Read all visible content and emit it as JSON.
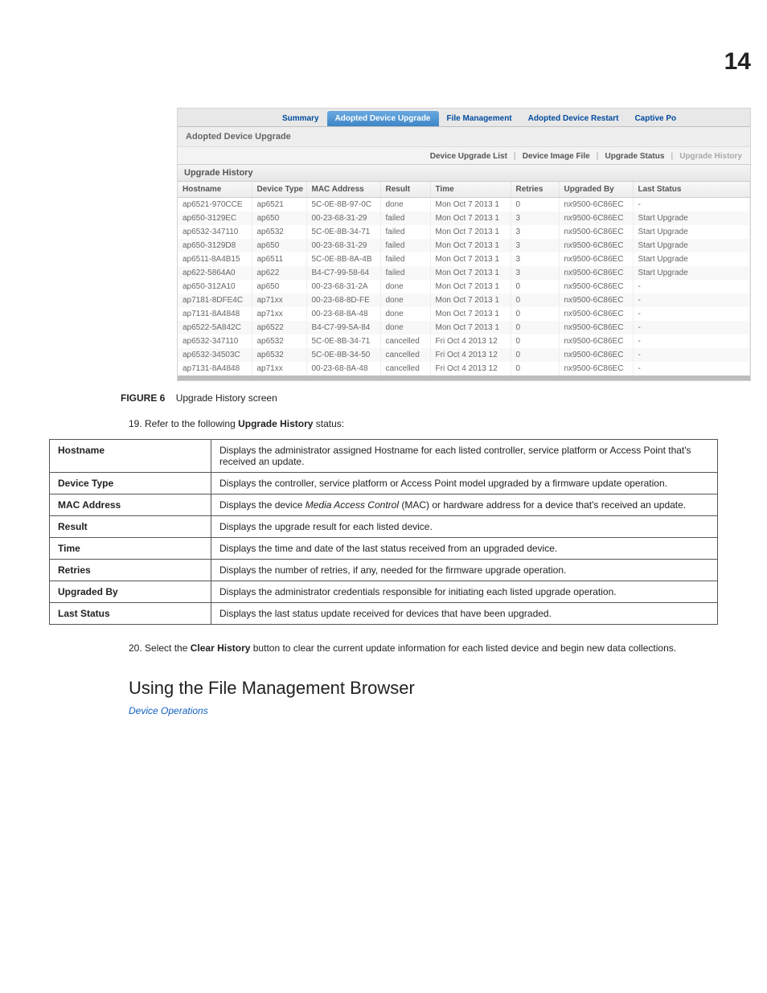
{
  "page_number": "14",
  "tabs": [
    "Summary",
    "Adopted Device Upgrade",
    "File Management",
    "Adopted Device Restart",
    "Captive Po"
  ],
  "panel_title": "Adopted Device Upgrade",
  "subtabs": [
    "Device Upgrade List",
    "Device Image File",
    "Upgrade Status",
    "Upgrade History"
  ],
  "table_caption": "Upgrade History",
  "columns": [
    "Hostname",
    "Device Type",
    "MAC Address",
    "Result",
    "Time",
    "Retries",
    "Upgraded By",
    "Last Status"
  ],
  "rows": [
    {
      "hostname": "ap6521-970CCE",
      "device": "ap6521",
      "mac": "5C-0E-8B-97-0C",
      "result": "done",
      "time": "Mon Oct 7 2013 1",
      "retries": "0",
      "by": "nx9500-6C86EC",
      "last": "-"
    },
    {
      "hostname": "ap650-3129EC",
      "device": "ap650",
      "mac": "00-23-68-31-29",
      "result": "failed",
      "time": "Mon Oct 7 2013 1",
      "retries": "3",
      "by": "nx9500-6C86EC",
      "last": "Start Upgrade"
    },
    {
      "hostname": "ap6532-347110",
      "device": "ap6532",
      "mac": "5C-0E-8B-34-71",
      "result": "failed",
      "time": "Mon Oct 7 2013 1",
      "retries": "3",
      "by": "nx9500-6C86EC",
      "last": "Start Upgrade"
    },
    {
      "hostname": "ap650-3129D8",
      "device": "ap650",
      "mac": "00-23-68-31-29",
      "result": "failed",
      "time": "Mon Oct 7 2013 1",
      "retries": "3",
      "by": "nx9500-6C86EC",
      "last": "Start Upgrade"
    },
    {
      "hostname": "ap6511-8A4B15",
      "device": "ap6511",
      "mac": "5C-0E-8B-8A-4B",
      "result": "failed",
      "time": "Mon Oct 7 2013 1",
      "retries": "3",
      "by": "nx9500-6C86EC",
      "last": "Start Upgrade"
    },
    {
      "hostname": "ap622-5864A0",
      "device": "ap622",
      "mac": "B4-C7-99-58-64",
      "result": "failed",
      "time": "Mon Oct 7 2013 1",
      "retries": "3",
      "by": "nx9500-6C86EC",
      "last": "Start Upgrade"
    },
    {
      "hostname": "ap650-312A10",
      "device": "ap650",
      "mac": "00-23-68-31-2A",
      "result": "done",
      "time": "Mon Oct 7 2013 1",
      "retries": "0",
      "by": "nx9500-6C86EC",
      "last": "-"
    },
    {
      "hostname": "ap7181-8DFE4C",
      "device": "ap71xx",
      "mac": "00-23-68-8D-FE",
      "result": "done",
      "time": "Mon Oct 7 2013 1",
      "retries": "0",
      "by": "nx9500-6C86EC",
      "last": "-"
    },
    {
      "hostname": "ap7131-8A4848",
      "device": "ap71xx",
      "mac": "00-23-68-8A-48",
      "result": "done",
      "time": "Mon Oct 7 2013 1",
      "retries": "0",
      "by": "nx9500-6C86EC",
      "last": "-"
    },
    {
      "hostname": "ap6522-5A842C",
      "device": "ap6522",
      "mac": "B4-C7-99-5A-84",
      "result": "done",
      "time": "Mon Oct 7 2013 1",
      "retries": "0",
      "by": "nx9500-6C86EC",
      "last": "-"
    },
    {
      "hostname": "ap6532-347110",
      "device": "ap6532",
      "mac": "5C-0E-8B-34-71",
      "result": "cancelled",
      "time": "Fri Oct 4 2013 12",
      "retries": "0",
      "by": "nx9500-6C86EC",
      "last": "-"
    },
    {
      "hostname": "ap6532-34503C",
      "device": "ap6532",
      "mac": "5C-0E-8B-34-50",
      "result": "cancelled",
      "time": "Fri Oct 4 2013 12",
      "retries": "0",
      "by": "nx9500-6C86EC",
      "last": "-"
    },
    {
      "hostname": "ap7131-8A4848",
      "device": "ap71xx",
      "mac": "00-23-68-8A-48",
      "result": "cancelled",
      "time": "Fri Oct 4 2013 12",
      "retries": "0",
      "by": "nx9500-6C86EC",
      "last": "-"
    }
  ],
  "figure": {
    "label": "FIGURE 6",
    "text": "Upgrade History screen"
  },
  "step19": {
    "num": "19. ",
    "pre": "Refer to the following ",
    "bold": "Upgrade History",
    "post": " status:"
  },
  "desc": [
    {
      "k": "Hostname",
      "v": "Displays the administrator assigned Hostname for each listed controller, service platform or Access Point that's received an update."
    },
    {
      "k": "Device Type",
      "v": "Displays the controller, service platform or Access Point model upgraded by a firmware update operation."
    },
    {
      "k": "MAC Address",
      "v": "Displays the device <em>Media Access Control</em> (MAC) or hardware address for a device that's received an update."
    },
    {
      "k": "Result",
      "v": "Displays the upgrade result for each listed device."
    },
    {
      "k": "Time",
      "v": "Displays the time and date of the last status received from an upgraded device."
    },
    {
      "k": "Retries",
      "v": "Displays the number of retries, if any, needed for the firmware upgrade operation."
    },
    {
      "k": "Upgraded By",
      "v": "Displays the administrator credentials responsible for initiating each listed upgrade operation."
    },
    {
      "k": "Last Status",
      "v": "Displays the last status update received for devices that have been upgraded."
    }
  ],
  "step20": {
    "num": "20. ",
    "pre": "Select the ",
    "bold": "Clear History",
    "post": " button to clear the current update information for each listed device and begin new data collections."
  },
  "heading": "Using the File Management Browser",
  "link": "Device Operations"
}
